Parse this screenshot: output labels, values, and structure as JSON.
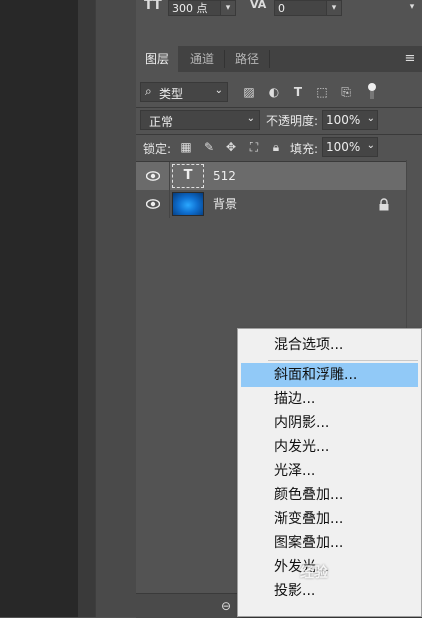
{
  "character": {
    "font_size": "300 点",
    "tracking": "0"
  },
  "tabs": [
    {
      "label": "图层",
      "active": true
    },
    {
      "label": "通道",
      "active": false
    },
    {
      "label": "路径",
      "active": false
    }
  ],
  "filter": {
    "kind_label": "类型"
  },
  "blend": {
    "mode": "正常",
    "opacity_label": "不透明度:",
    "opacity_value": "100%"
  },
  "lock": {
    "label": "锁定:",
    "fill_label": "填充:",
    "fill_value": "100%"
  },
  "layers": [
    {
      "name": "512",
      "type": "text",
      "selected": true
    },
    {
      "name": "背景",
      "type": "image",
      "selected": false,
      "locked": true
    }
  ],
  "context_menu": {
    "items": [
      {
        "label": "混合选项..."
      },
      {
        "label": "斜面和浮雕...",
        "highlighted": true
      },
      {
        "label": "描边..."
      },
      {
        "label": "内阴影..."
      },
      {
        "label": "内发光..."
      },
      {
        "label": "光泽..."
      },
      {
        "label": "颜色叠加..."
      },
      {
        "label": "渐变叠加..."
      },
      {
        "label": "图案叠加..."
      },
      {
        "label": "外发光..."
      },
      {
        "label": "投影..."
      }
    ]
  },
  "watermark": "经验",
  "colors": {
    "panel_bg": "#535353",
    "menu_bg": "#f0f0f0",
    "menu_highlight": "#91c9f7"
  }
}
